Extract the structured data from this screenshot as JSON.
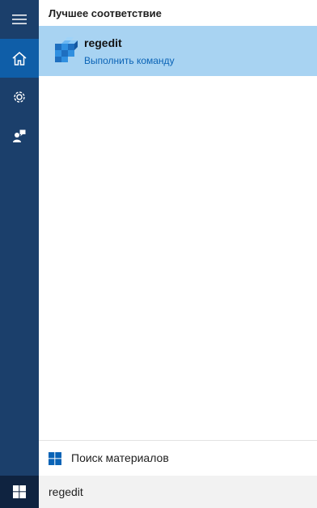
{
  "results": {
    "section_header": "Лучшее соответствие",
    "best_match": {
      "name": "regedit",
      "action": "Выполнить команду"
    }
  },
  "footer": {
    "store_search_label": "Поиск материалов"
  },
  "search": {
    "query": "regedit"
  },
  "rail": {
    "active_item": "home"
  },
  "colors": {
    "rail_bg": "#1b3f6b",
    "rail_active": "#0f5ea8",
    "result_highlight": "#a8d3f2",
    "link_blue": "#0a63b6",
    "taskbar_bg": "#0f2340"
  }
}
